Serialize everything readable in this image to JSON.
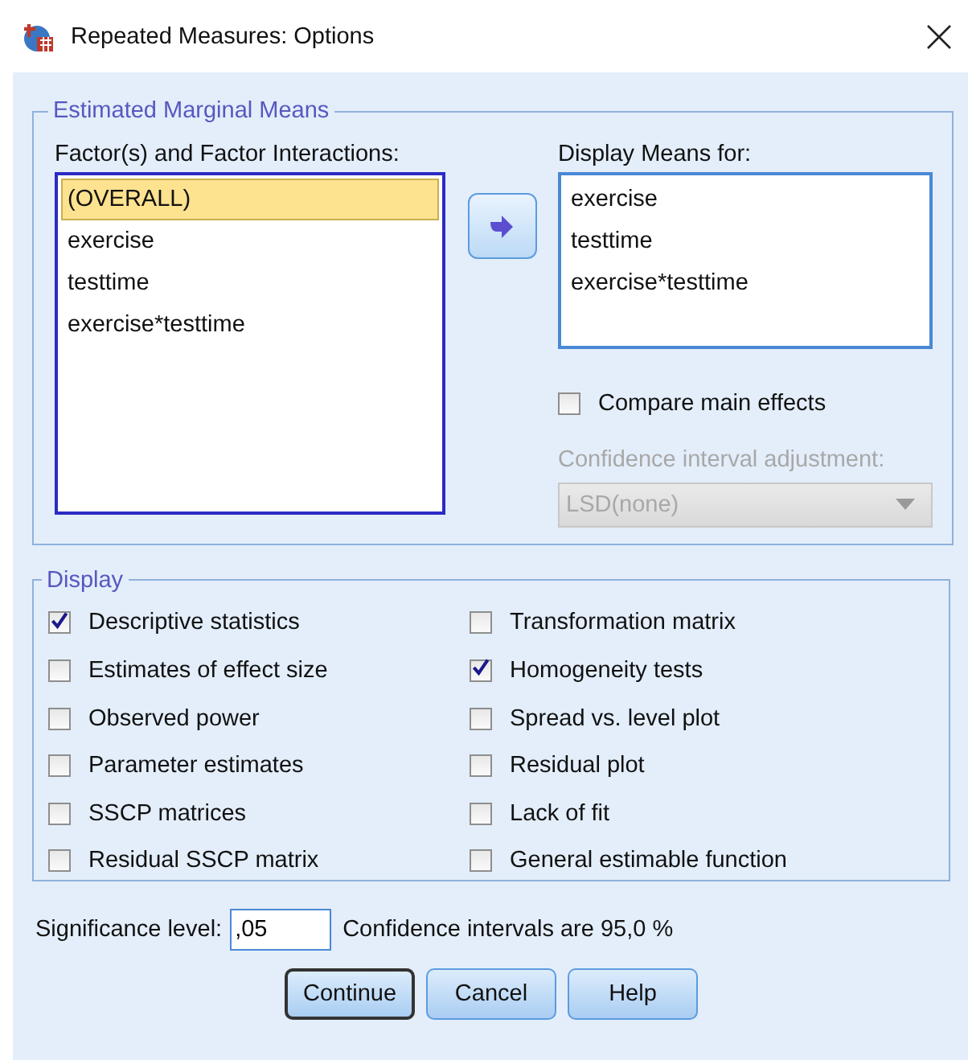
{
  "window": {
    "title": "Repeated Measures: Options"
  },
  "marginal_means": {
    "title": "Estimated Marginal Means",
    "factors": {
      "label": "Factor(s) and Factor Interactions:",
      "items": [
        {
          "label": "(OVERALL)",
          "selected": true
        },
        {
          "label": "exercise",
          "selected": false
        },
        {
          "label": "testtime",
          "selected": false
        },
        {
          "label": "exercise*testtime",
          "selected": false
        }
      ]
    },
    "display_means": {
      "label": "Display Means for:",
      "items": [
        {
          "label": "exercise",
          "selected": false
        },
        {
          "label": "testtime",
          "selected": false
        },
        {
          "label": "exercise*testtime",
          "selected": false
        }
      ]
    },
    "compare_main_effects": {
      "label": "Compare main effects",
      "checked": false
    },
    "ci_adjustment": {
      "label": "Confidence interval adjustment:",
      "value": "LSD(none)",
      "disabled": true
    }
  },
  "display": {
    "title": "Display",
    "options": [
      {
        "label": "Descriptive statistics",
        "checked": true
      },
      {
        "label": "Transformation matrix",
        "checked": false
      },
      {
        "label": "Estimates of effect size",
        "checked": false
      },
      {
        "label": "Homogeneity tests",
        "checked": true
      },
      {
        "label": "Observed power",
        "checked": false
      },
      {
        "label": "Spread vs. level plot",
        "checked": false
      },
      {
        "label": "Parameter estimates",
        "checked": false
      },
      {
        "label": "Residual plot",
        "checked": false
      },
      {
        "label": "SSCP matrices",
        "checked": false
      },
      {
        "label": "Lack of fit",
        "checked": false
      },
      {
        "label": "Residual SSCP matrix",
        "checked": false
      },
      {
        "label": "General estimable function",
        "checked": false
      }
    ]
  },
  "significance": {
    "label": "Significance level:",
    "value": ",05",
    "note": "Confidence intervals are 95,0 %"
  },
  "buttons": [
    {
      "label": "Continue",
      "default": true
    },
    {
      "label": "Cancel",
      "default": false
    },
    {
      "label": "Help",
      "default": false
    }
  ]
}
